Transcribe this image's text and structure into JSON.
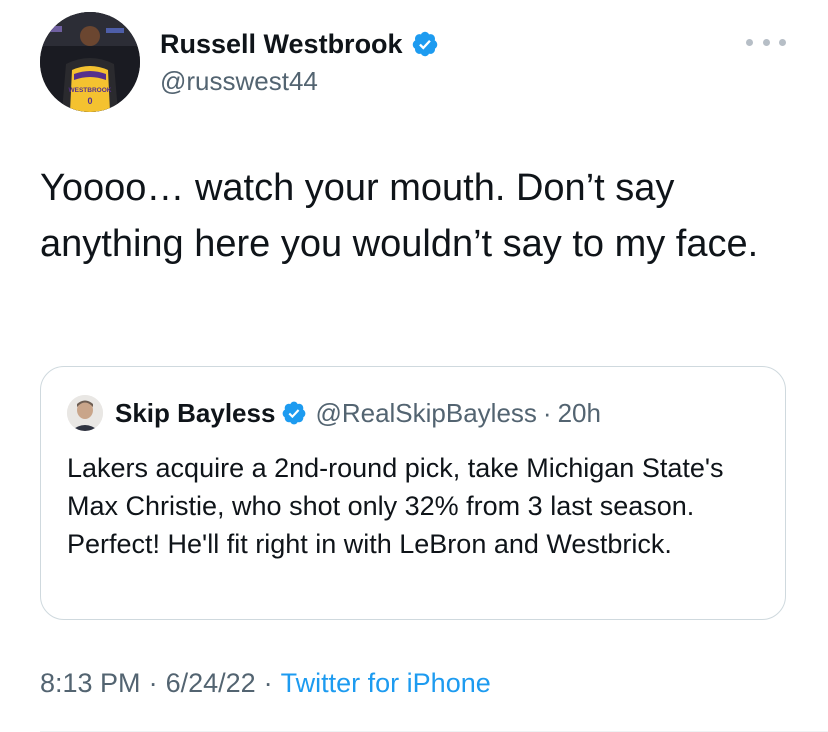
{
  "author": {
    "name": "Russell Westbrook",
    "handle": "@russwest44",
    "verified_icon": "verified-badge-icon",
    "avatar_jersey_text": "WESTBROOK",
    "avatar_jersey_number": "0"
  },
  "tweet": {
    "text": "Yoooo… watch your mouth. Don’t say anything here you wouldn’t say to my face."
  },
  "quoted_tweet": {
    "name": "Skip Bayless",
    "handle": "@RealSkipBayless",
    "separator": "·",
    "time": "20h",
    "text": "Lakers acquire a 2nd-round pick, take Michigan State's Max Christie, who shot only 32% from 3 last season. Perfect! He'll fit right in with LeBron and Westbrick."
  },
  "meta": {
    "time": "8:13 PM",
    "separator": "·",
    "date": "6/24/22",
    "source": "Twitter for iPhone"
  },
  "colors": {
    "accent": "#1d9bf0",
    "secondary_text": "#536471",
    "border": "#cfd9de"
  },
  "icons": {
    "more": "more-options-icon",
    "verified": "verified-badge-icon"
  }
}
